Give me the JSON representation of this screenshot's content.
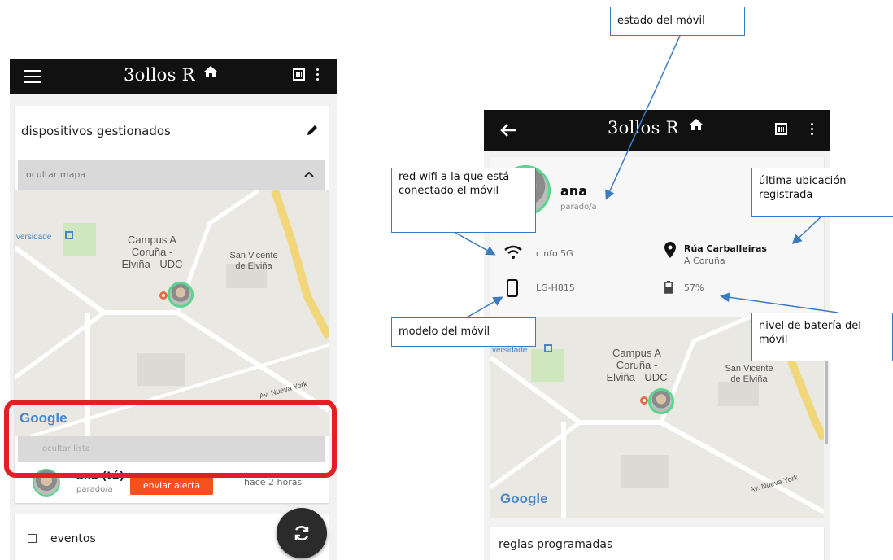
{
  "left_screen": {
    "app_title": "3ollos R",
    "card_title": "dispositivos gestionados",
    "hide_map_label": "ocultar mapa",
    "map": {
      "label_campus": "Campus A\nCoruña -\nElviña - UDC",
      "label_san_vicente": "San Vicente\nde Elviña",
      "label_versidade": "versidade",
      "label_nueva_york": "Av. Nueva York",
      "google": "Google"
    },
    "collapsed_label": "ocultar lista",
    "device": {
      "name": "ana (tú)",
      "status": "parado/a",
      "time": "hace 2 horas"
    },
    "alert_button": "enviar alerta",
    "events_label": "eventos"
  },
  "right_screen": {
    "app_title": "3ollos R",
    "profile": {
      "name": "ana",
      "status": "parado/a"
    },
    "wifi": "cinfo 5G",
    "location_line1": "Rúa Carballeiras",
    "location_line2": "A Coruña",
    "device_model": "LG-H815",
    "battery": "57%",
    "map": {
      "label_campus": "Campus A\nCoruña -\nElviña - UDC",
      "label_san_vicente": "San Vicente\nde Elviña",
      "label_versidade": "versidade",
      "label_nueva_york": "Av. Nueva York",
      "google": "Google"
    },
    "rules_label": "reglas programadas"
  },
  "annotations": {
    "estado": "estado del móvil",
    "red_wifi": "red wifi a la que está conectado el móvil",
    "ubicacion": "última ubicación registrada",
    "modelo": "modelo del móvil",
    "bateria": "nivel de batería del móvil"
  },
  "colors": {
    "appbar": "#111111",
    "highlight_border": "#e31e24",
    "alert_button": "#f4511e",
    "annotation_border": "#3a7bbf",
    "avatar_ring": "#58d68d"
  }
}
